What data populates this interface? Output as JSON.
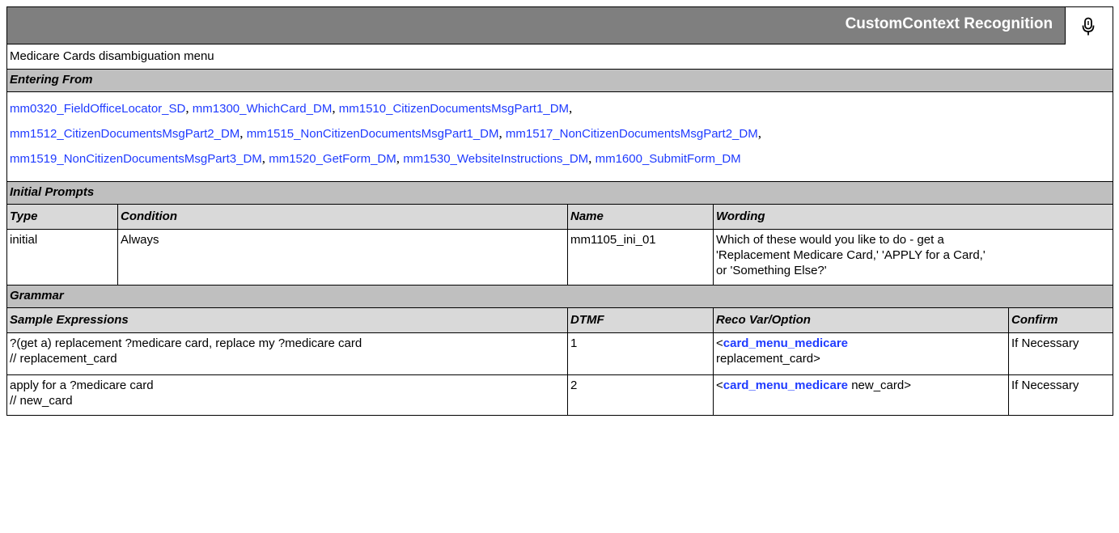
{
  "header": {
    "title": "CustomContext Recognition",
    "icon": "microphone-icon"
  },
  "description": "Medicare Cards disambiguation menu",
  "entering_from": {
    "label": "Entering From",
    "links": [
      "mm0320_FieldOfficeLocator_SD",
      "mm1300_WhichCard_DM",
      "mm1510_CitizenDocumentsMsgPart1_DM",
      "mm1512_CitizenDocumentsMsgPart2_DM",
      "mm1515_NonCitizenDocumentsMsgPart1_DM",
      "mm1517_NonCitizenDocumentsMsgPart2_DM",
      "mm1519_NonCitizenDocumentsMsgPart3_DM",
      "mm1520_GetForm_DM",
      "mm1530_WebsiteInstructions_DM",
      "mm1600_SubmitForm_DM"
    ],
    "separator": ","
  },
  "initial_prompts": {
    "label": "Initial Prompts",
    "columns": [
      "Type",
      "Condition",
      "Name",
      "Wording"
    ],
    "rows": [
      {
        "type": "initial",
        "condition": "Always",
        "name": "mm1105_ini_01",
        "wording": "Which of these would you like to do - get a 'Replacement Medicare Card,' 'APPLY for a Card,' or 'Something Else?'"
      }
    ]
  },
  "grammar": {
    "label": "Grammar",
    "columns": [
      "Sample Expressions",
      "DTMF",
      "Reco Var/Option",
      "Confirm"
    ],
    "rows": [
      {
        "expr_line1": "?(get a) replacement ?medicare card, replace my ?medicare card",
        "expr_line2": "// replacement_card",
        "dtmf": "1",
        "reco_open": "<",
        "reco_var": "card_menu_medicare",
        "reco_value": "replacement_card>",
        "confirm": "If Necessary"
      },
      {
        "expr_line1": "apply for a ?medicare card",
        "expr_line2": "// new_card",
        "dtmf": "2",
        "reco_open": "<",
        "reco_var": "card_menu_medicare",
        "reco_value": "new_card>",
        "confirm": "If Necessary"
      }
    ]
  }
}
